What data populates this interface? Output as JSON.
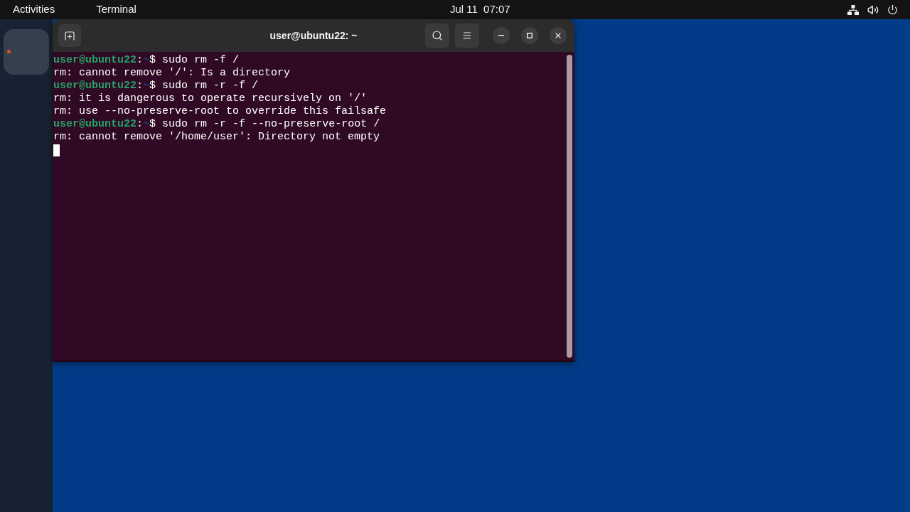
{
  "top_bar": {
    "activities": "Activities",
    "app_menu": "Terminal",
    "clock": "Jul 11  07:07"
  },
  "dock": {
    "items": [
      {
        "running": true
      }
    ]
  },
  "window": {
    "title": "user@ubuntu22: ~"
  },
  "terminal": {
    "lines": [
      {
        "kind": "prompt",
        "user_host": "user@ubuntu22",
        "separator": ":",
        "path": "~",
        "prompt_symbol": "$",
        "command": "sudo rm -f /"
      },
      {
        "kind": "output",
        "text": "rm: cannot remove '/': Is a directory"
      },
      {
        "kind": "prompt",
        "user_host": "user@ubuntu22",
        "separator": ":",
        "path": "~",
        "prompt_symbol": "$",
        "command": "sudo rm -r -f /"
      },
      {
        "kind": "output",
        "text": "rm: it is dangerous to operate recursively on '/'"
      },
      {
        "kind": "output",
        "text": "rm: use --no-preserve-root to override this failsafe"
      },
      {
        "kind": "prompt",
        "user_host": "user@ubuntu22",
        "separator": ":",
        "path": "~",
        "prompt_symbol": "$",
        "command": "sudo rm -r -f --no-preserve-root /"
      },
      {
        "kind": "output",
        "text": "rm: cannot remove '/home/user': Directory not empty"
      }
    ],
    "cursor_visible": true
  }
}
